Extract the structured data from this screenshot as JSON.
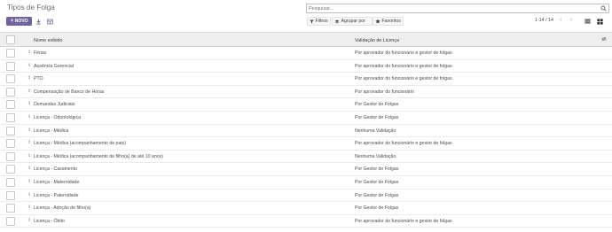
{
  "control_panel": {
    "title": "Tipos de Folga",
    "new_button_label": "NOVO",
    "search": {
      "placeholder": "Pesquisar...",
      "value": ""
    },
    "filters": [
      {
        "label": "Filtros",
        "icon": "filter-icon"
      },
      {
        "label": "Agrupar por",
        "icon": "layers-icon"
      },
      {
        "label": "Favoritos",
        "icon": "star-icon"
      }
    ],
    "pager": {
      "range": "1-14 / 14"
    }
  },
  "table": {
    "columns": [
      "Nome exibido",
      "Validação de Licença"
    ],
    "rows": [
      {
        "name": "Férias",
        "validation": "Por aprovador do funcionário e gestor de folgas"
      },
      {
        "name": "Ausência Gerencial",
        "validation": "Por aprovador do funcionário e gestor de folgas"
      },
      {
        "name": "PTO",
        "validation": "Por aprovador do funcionário e gestor de folgas"
      },
      {
        "name": "Compensação de Banco de Horas",
        "validation": "Por aprovador do funcionário"
      },
      {
        "name": "Demandas Judiciais",
        "validation": "Por Gestor de Folgas"
      },
      {
        "name": "Licença - Odontológica",
        "validation": "Por Gestor de Folgas"
      },
      {
        "name": "Licença - Médica",
        "validation": "Nenhuma Validação"
      },
      {
        "name": "Licença - Médica (acompanhamento de pais)",
        "validation": "Por aprovador do funcionário e gestor de folgas"
      },
      {
        "name": "Licença - Médica (acompanhamento de filho(a) de até 10 anos)",
        "validation": "Nenhuma Validação"
      },
      {
        "name": "Licença - Casamento",
        "validation": "Por Gestor de Folgas"
      },
      {
        "name": "Licença - Maternidade",
        "validation": "Por Gestor de Folgas"
      },
      {
        "name": "Licença - Paternidade",
        "validation": "Por Gestor de Folgas"
      },
      {
        "name": "Licença - Adoção de filho(a)",
        "validation": "Por Gestor de Folgas"
      },
      {
        "name": "Licença - Óbito",
        "validation": "Por aprovador do funcionário e gestor de folgas"
      }
    ]
  },
  "colors": {
    "accent": "#71639e",
    "header_bg": "#eeeeee",
    "border": "#ebebeb"
  }
}
